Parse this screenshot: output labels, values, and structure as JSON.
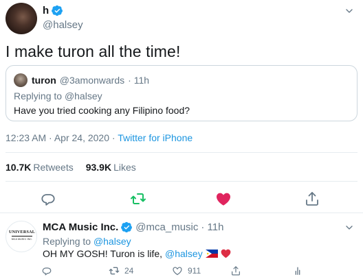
{
  "main_tweet": {
    "author_name": "h",
    "author_handle": "@halsey",
    "text": "I make turon all the time!",
    "timestamp": "12:23 AM · Apr 24, 2020",
    "source": "Twitter for iPhone",
    "timestamp_sep": " · ",
    "stats": {
      "retweets_count": "10.7K",
      "retweets_label": "Retweets",
      "likes_count": "93.9K",
      "likes_label": "Likes"
    }
  },
  "quoted_tweet": {
    "author_name": "turon",
    "author_handle": "@3amonwards",
    "time": "· 11h",
    "replying_prefix": "Replying to",
    "replying_to": "@halsey",
    "text": "Have you tried cooking any Filipino food?"
  },
  "reply_tweet": {
    "author_name": "MCA Music Inc.",
    "author_handle": "@mca_music",
    "time": "· 11h",
    "replying_prefix": "Replying to",
    "replying_to": "@halsey",
    "text": "OH MY GOSH! Turon is life,",
    "mention": "@halsey",
    "avatar_logo_top": "UNIVERSAL",
    "avatar_logo_bottom": "MCA MUSIC INC.",
    "retweet_count": "24",
    "like_count": "911"
  },
  "colors": {
    "accent": "#1b95e0",
    "retweet_green": "#17bf63",
    "like_red": "#e0245e",
    "secondary_text": "#657786"
  },
  "icons": [
    "verified-badge-icon",
    "chevron-down-icon",
    "reply-icon",
    "retweet-icon",
    "like-icon",
    "share-icon",
    "kebab-icon",
    "analytics-icon",
    "philippines-flag-icon",
    "red-heart-icon"
  ]
}
